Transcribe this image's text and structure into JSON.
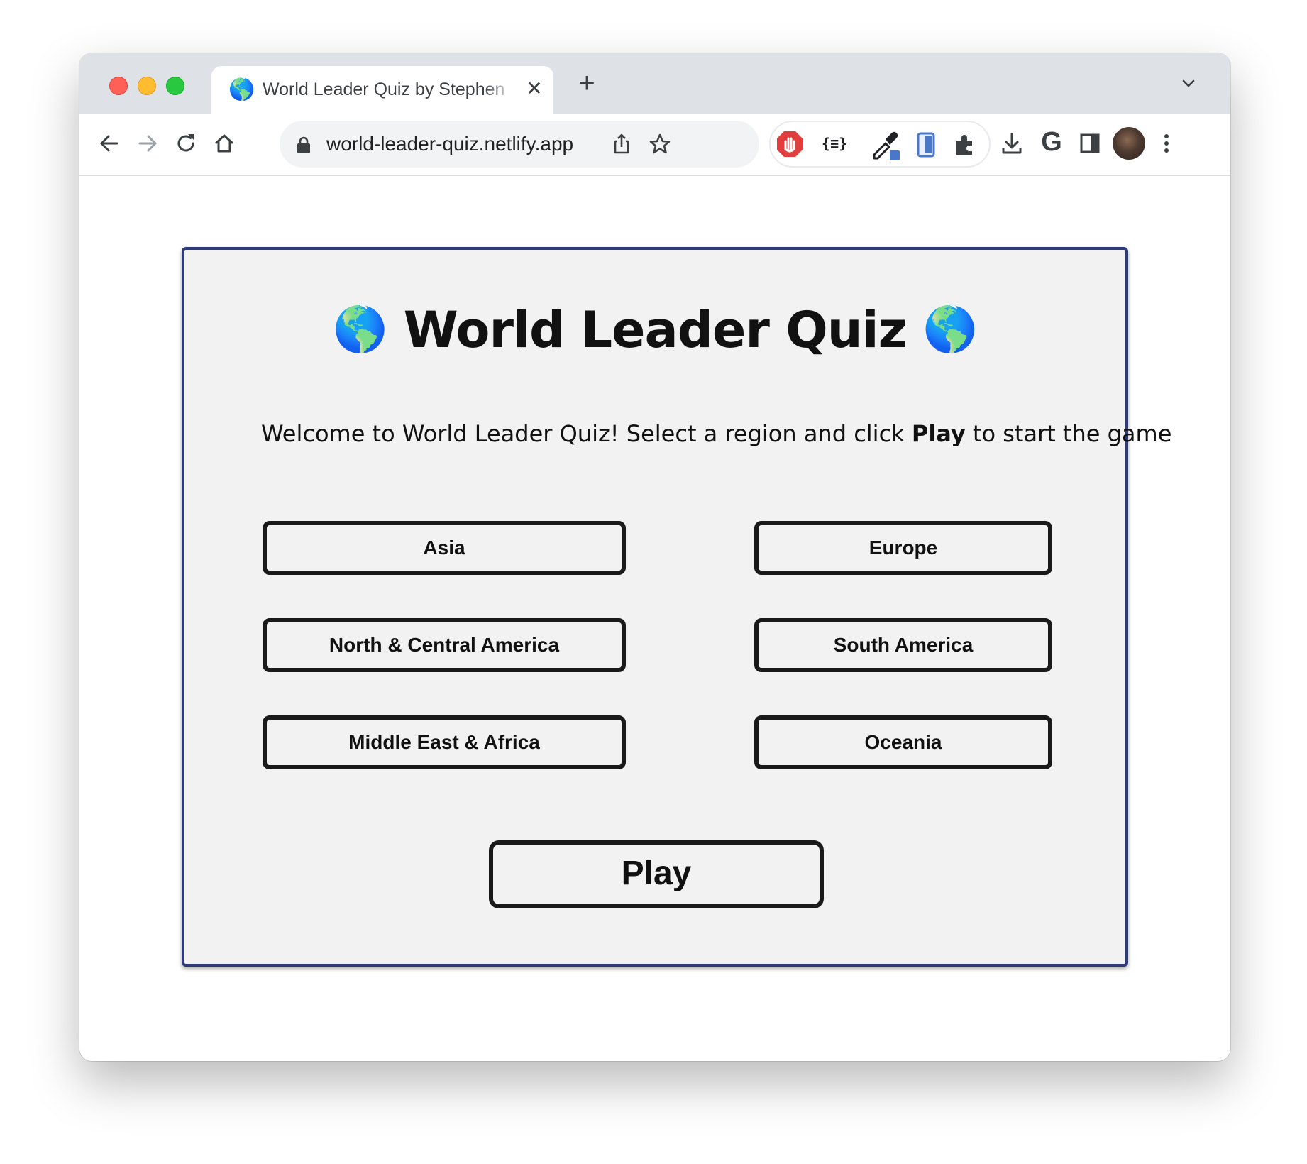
{
  "browser": {
    "tab": {
      "title": "World Leader Quiz by Stephen",
      "favicon": "🌎",
      "close_icon": "✕"
    },
    "new_tab_icon": "+",
    "address": {
      "url": "world-leader-quiz.netlify.app"
    },
    "toolbar_icons": [
      "back-icon",
      "forward-icon",
      "reload-icon",
      "home-icon",
      "lock-icon",
      "share-icon",
      "bookmark-star-icon",
      "adblock-icon",
      "json-viewer-icon",
      "color-picker-icon",
      "device-mode-icon",
      "extensions-icon",
      "download-icon",
      "google-icon",
      "side-panel-icon",
      "profile-avatar",
      "menu-icon"
    ],
    "json_ext_label": "{≡}",
    "google_label": "G"
  },
  "quiz": {
    "globe_left": "🌎",
    "title": "World Leader Quiz",
    "globe_right": "🌎",
    "welcome_prefix": "Welcome to World Leader Quiz! Select a region and click ",
    "welcome_bold": "Play",
    "welcome_suffix": " to start the game",
    "regions": {
      "asia": "Asia",
      "europe": "Europe",
      "north_central_america": "North & Central America",
      "south_america": "South America",
      "middle_east_africa": "Middle East & Africa",
      "oceania": "Oceania"
    },
    "play_label": "Play"
  },
  "colors": {
    "card_border": "#2d3a7c",
    "card_bg": "#f2f2f2",
    "button_border": "#1a1a1a"
  }
}
